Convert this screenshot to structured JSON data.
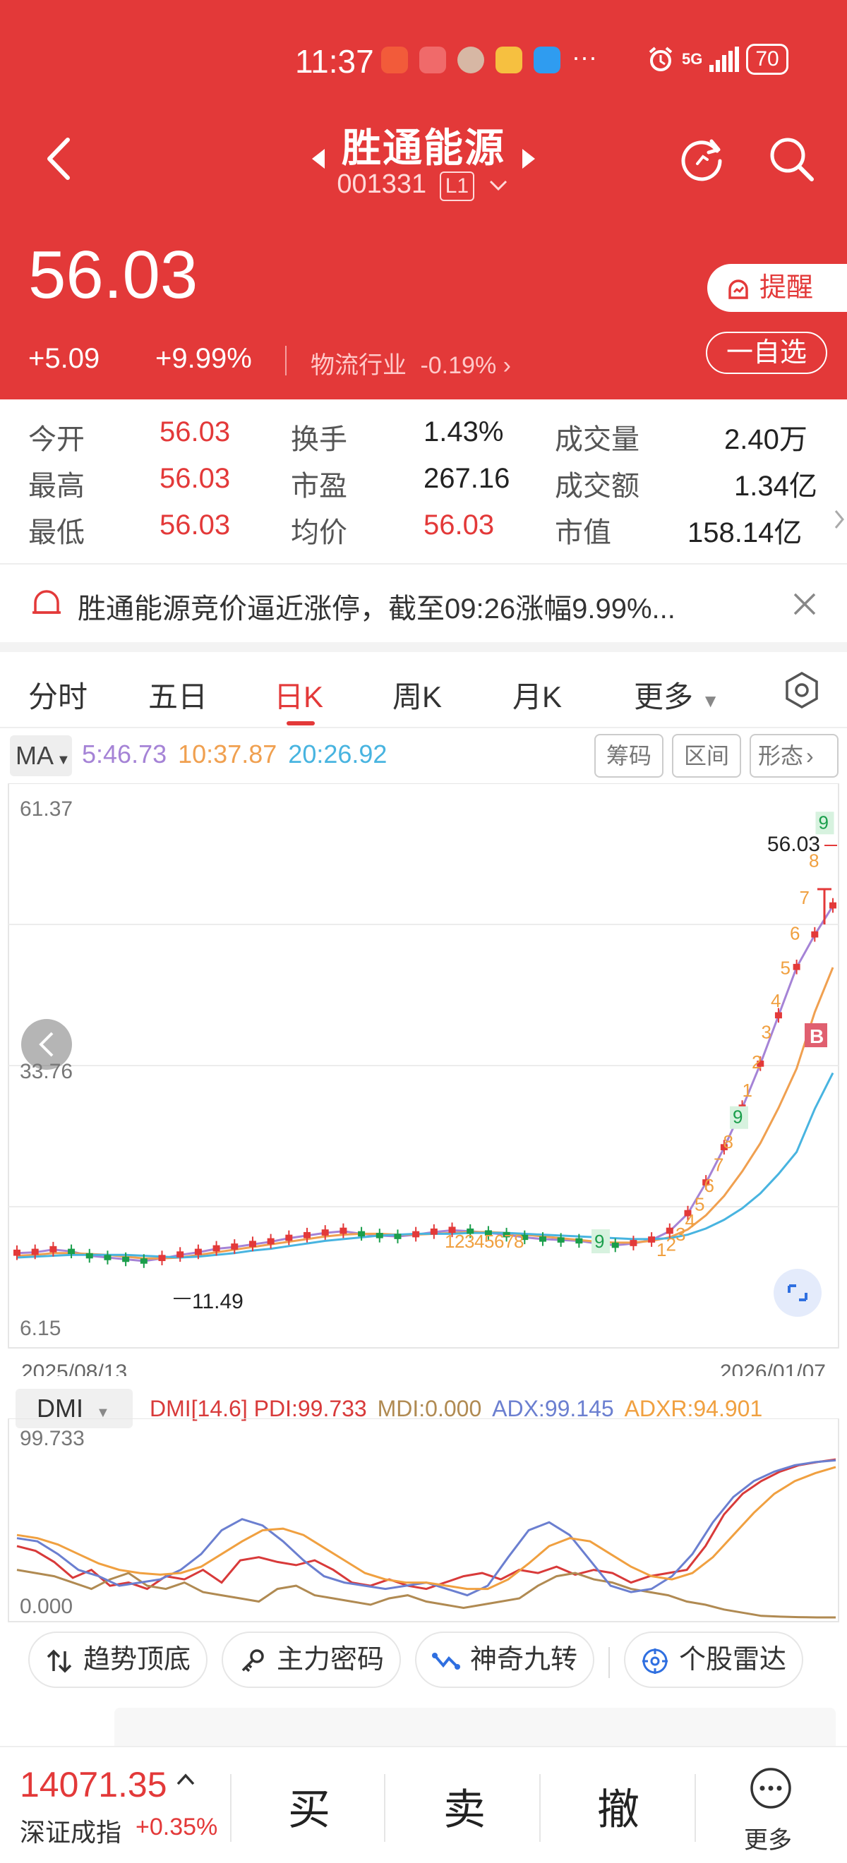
{
  "status_bar": {
    "time": "11:37",
    "battery": "70",
    "network": "5G"
  },
  "header": {
    "stock_name": "胜通能源",
    "stock_code": "001331",
    "level_badge": "L1",
    "price": "56.03",
    "change": "+5.09",
    "change_pct": "+9.99%",
    "industry": "物流行业",
    "industry_change": "-0.19%",
    "remind_label": "提醒",
    "watchlist_label": "一自选"
  },
  "stats": [
    {
      "label": "今开",
      "value": "56.03"
    },
    {
      "label": "换手",
      "value": "1.43%"
    },
    {
      "label": "成交量",
      "value": "2.40万"
    },
    {
      "label": "最高",
      "value": "56.03"
    },
    {
      "label": "市盈",
      "value": "267.16"
    },
    {
      "label": "成交额",
      "value": "1.34亿"
    },
    {
      "label": "最低",
      "value": "56.03"
    },
    {
      "label": "均价",
      "value": "56.03"
    },
    {
      "label": "市值",
      "value": "158.14亿"
    }
  ],
  "news": {
    "text": "胜通能源竞价逼近涨停，截至09:26涨幅9.99%..."
  },
  "tabs": [
    "分时",
    "五日",
    "日K",
    "周K",
    "月K",
    "更多"
  ],
  "active_tab": "日K",
  "ma_bar": {
    "label": "MA",
    "ma5": "5:46.73",
    "ma10": "10:37.87",
    "ma20": "20:26.92",
    "tools": [
      "筹码",
      "区间",
      "形态"
    ]
  },
  "colors": {
    "up": "#e33939",
    "down": "#1a9e4b",
    "ma5": "#a583d6",
    "ma10": "#f0a050",
    "ma20": "#48b4e0",
    "pdi": "#d83a3a",
    "mdi": "#b08a52",
    "adx": "#6b7fd0",
    "adxr": "#f0a040"
  },
  "chart_data": [
    {
      "type": "candlestick",
      "y_top_label": "61.37",
      "y_mid_label": "33.76",
      "y_bottom_label": "6.15",
      "ylim": [
        6.15,
        61.37
      ],
      "x_start_label": "2025/08/13",
      "x_end_label": "2026/01/07",
      "last_price_label": "56.03",
      "low_marker_label": "11.49",
      "nine_turn_labels_first": [
        "1",
        "2",
        "3",
        "4",
        "5",
        "6",
        "7",
        "8",
        "9"
      ],
      "nine_turn_labels_second": [
        "1",
        "2",
        "3",
        "4",
        "5",
        "6",
        "7",
        "8",
        "9",
        "1",
        "2",
        "3",
        "4",
        "5",
        "6",
        "7",
        "8",
        "9"
      ],
      "buy_marker": "B",
      "series": [
        {
          "name": "5",
          "values": [
            10.5,
            10.6,
            10.9,
            10.7,
            10.2,
            10.0,
            9.8,
            9.6,
            9.9,
            10.3,
            10.6,
            11.0,
            11.2,
            11.5,
            11.8,
            12.2,
            12.5,
            12.8,
            13.0,
            12.7,
            12.5,
            12.4,
            12.6,
            12.9,
            13.1,
            13.0,
            12.8,
            12.6,
            12.3,
            12.1,
            12.0,
            11.9,
            11.6,
            11.4,
            11.6,
            12.0,
            13.0,
            15.0,
            18.5,
            22.5,
            27.0,
            32.0,
            37.5,
            43.0,
            46.7,
            50.0
          ]
        },
        {
          "name": "10",
          "values": [
            10.2,
            10.3,
            10.5,
            10.5,
            10.4,
            10.3,
            10.1,
            9.9,
            9.9,
            10.0,
            10.3,
            10.6,
            10.9,
            11.2,
            11.5,
            11.8,
            12.1,
            12.4,
            12.6,
            12.7,
            12.7,
            12.6,
            12.6,
            12.7,
            12.8,
            12.9,
            12.9,
            12.8,
            12.6,
            12.4,
            12.2,
            12.0,
            11.8,
            11.7,
            11.7,
            11.9,
            12.3,
            13.2,
            14.8,
            17.0,
            19.8,
            23.0,
            27.0,
            31.5,
            37.9,
            43.0
          ]
        },
        {
          "name": "20",
          "values": [
            10.0,
            10.1,
            10.2,
            10.3,
            10.3,
            10.3,
            10.3,
            10.2,
            10.1,
            10.0,
            10.1,
            10.3,
            10.5,
            10.8,
            11.0,
            11.3,
            11.6,
            11.9,
            12.1,
            12.3,
            12.5,
            12.6,
            12.7,
            12.7,
            12.7,
            12.8,
            12.8,
            12.8,
            12.7,
            12.6,
            12.5,
            12.4,
            12.3,
            12.2,
            12.1,
            12.1,
            12.2,
            12.6,
            13.3,
            14.3,
            15.6,
            17.3,
            19.5,
            22.0,
            26.9,
            31.0
          ]
        }
      ]
    },
    {
      "type": "line",
      "indicator": "DMI",
      "params": "DMI[14.6]",
      "y_top_label": "99.733",
      "y_bottom_label": "0.000",
      "ylim": [
        0,
        99.733
      ],
      "series": [
        {
          "name": "PDI",
          "label": "PDI:99.733",
          "values": [
            45,
            42,
            35,
            25,
            30,
            20,
            22,
            18,
            26,
            24,
            30,
            22,
            36,
            38,
            35,
            33,
            36,
            30,
            22,
            20,
            24,
            20,
            18,
            22,
            26,
            28,
            24,
            30,
            28,
            32,
            27,
            30,
            28,
            22,
            26,
            28,
            30,
            45,
            65,
            78,
            86,
            92,
            96,
            98,
            99.7
          ]
        },
        {
          "name": "MDI",
          "label": "MDI:0.000",
          "values": [
            30,
            28,
            26,
            22,
            18,
            24,
            28,
            20,
            18,
            22,
            16,
            14,
            12,
            10,
            18,
            20,
            14,
            12,
            10,
            8,
            12,
            14,
            10,
            8,
            6,
            8,
            10,
            12,
            20,
            26,
            28,
            24,
            22,
            18,
            16,
            14,
            10,
            8,
            5,
            3,
            1,
            0.5,
            0.2,
            0,
            0
          ]
        },
        {
          "name": "ADX",
          "label": "ADX:99.145",
          "values": [
            50,
            48,
            40,
            30,
            26,
            20,
            22,
            24,
            30,
            40,
            55,
            62,
            58,
            48,
            36,
            26,
            22,
            20,
            18,
            20,
            22,
            18,
            14,
            20,
            38,
            55,
            60,
            52,
            36,
            20,
            16,
            18,
            26,
            40,
            60,
            76,
            86,
            92,
            96,
            98,
            99.1
          ]
        },
        {
          "name": "ADXR",
          "label": "ADXR:94.901",
          "values": [
            52,
            50,
            46,
            40,
            34,
            30,
            28,
            27,
            28,
            32,
            40,
            48,
            55,
            56,
            52,
            44,
            36,
            28,
            24,
            22,
            22,
            20,
            18,
            18,
            24,
            34,
            45,
            50,
            48,
            40,
            32,
            26,
            24,
            28,
            38,
            52,
            66,
            78,
            86,
            91,
            94.9
          ]
        }
      ]
    }
  ],
  "dmi_bar": {
    "label": "DMI",
    "params": "DMI[14.6]",
    "pdi": "PDI:99.733",
    "mdi": "MDI:0.000",
    "adx": "ADX:99.145",
    "adxr": "ADXR:94.901"
  },
  "chips": [
    "趋势顶底",
    "主力密码",
    "神奇九转",
    "个股雷达"
  ],
  "bottom": {
    "index_value": "14071.35",
    "index_name": "深证成指",
    "index_pct": "+0.35%",
    "actions": [
      "买",
      "卖",
      "撤"
    ],
    "more_label": "更多"
  }
}
